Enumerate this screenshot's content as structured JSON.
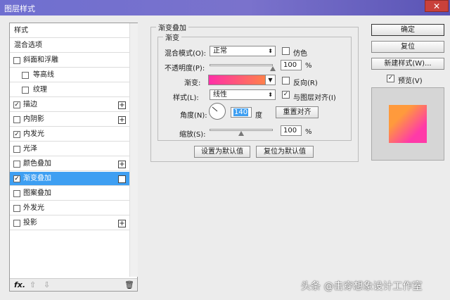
{
  "window": {
    "title": "图层样式",
    "close_icon": "close-icon"
  },
  "styles_list": {
    "items": [
      {
        "label": "样式",
        "checkbox": false,
        "sub": false,
        "plus": false,
        "checked": false,
        "selected": false
      },
      {
        "label": "混合选项",
        "checkbox": false,
        "sub": false,
        "plus": false,
        "checked": false,
        "selected": false
      },
      {
        "label": "斜面和浮雕",
        "checkbox": true,
        "sub": false,
        "plus": false,
        "checked": false,
        "selected": false
      },
      {
        "label": "等高线",
        "checkbox": true,
        "sub": true,
        "plus": false,
        "checked": false,
        "selected": false
      },
      {
        "label": "纹理",
        "checkbox": true,
        "sub": true,
        "plus": false,
        "checked": false,
        "selected": false
      },
      {
        "label": "描边",
        "checkbox": true,
        "sub": false,
        "plus": true,
        "checked": true,
        "selected": false
      },
      {
        "label": "内阴影",
        "checkbox": true,
        "sub": false,
        "plus": true,
        "checked": false,
        "selected": false
      },
      {
        "label": "内发光",
        "checkbox": true,
        "sub": false,
        "plus": false,
        "checked": true,
        "selected": false
      },
      {
        "label": "光泽",
        "checkbox": true,
        "sub": false,
        "plus": false,
        "checked": false,
        "selected": false
      },
      {
        "label": "颜色叠加",
        "checkbox": true,
        "sub": false,
        "plus": true,
        "checked": false,
        "selected": false
      },
      {
        "label": "渐变叠加",
        "checkbox": true,
        "sub": false,
        "plus": true,
        "checked": true,
        "selected": true
      },
      {
        "label": "图案叠加",
        "checkbox": true,
        "sub": false,
        "plus": false,
        "checked": false,
        "selected": false
      },
      {
        "label": "外发光",
        "checkbox": true,
        "sub": false,
        "plus": false,
        "checked": false,
        "selected": false
      },
      {
        "label": "投影",
        "checkbox": true,
        "sub": false,
        "plus": true,
        "checked": false,
        "selected": false
      }
    ],
    "footer": {
      "fx": "fx.",
      "up": "⇧",
      "down": "⇩",
      "trash": "🗑"
    }
  },
  "gradient_overlay": {
    "section_title": "渐变叠加",
    "group_title": "渐变",
    "blend_mode_label": "混合模式(O):",
    "blend_mode_value": "正常",
    "dither_label": "仿色",
    "opacity_label": "不透明度(P):",
    "opacity_value": "100",
    "percent": "%",
    "gradient_label": "渐变:",
    "reverse_label": "反向(R)",
    "style_label": "样式(L):",
    "style_value": "线性",
    "align_label": "与图层对齐(I)",
    "angle_label": "角度(N):",
    "angle_value": "140",
    "degree": "度",
    "reset_align_button": "重置对齐",
    "scale_label": "缩放(S):",
    "scale_value": "100",
    "opacity_level": 1.0,
    "scale_level": 0.5,
    "set_default_button": "设置为默认值",
    "reset_default_button": "复位为默认值"
  },
  "actions": {
    "ok": "确定",
    "reset": "复位",
    "new_style": "新建样式(W)...",
    "preview_label": "预览(V)"
  },
  "watermark": "头条 @击穿想象设计工作室",
  "colors": {
    "title_bar": "#6f6fd0",
    "selected": "#3e9ff2",
    "gradient_start": "#ff2fa8",
    "gradient_end": "#ff8f3a"
  }
}
